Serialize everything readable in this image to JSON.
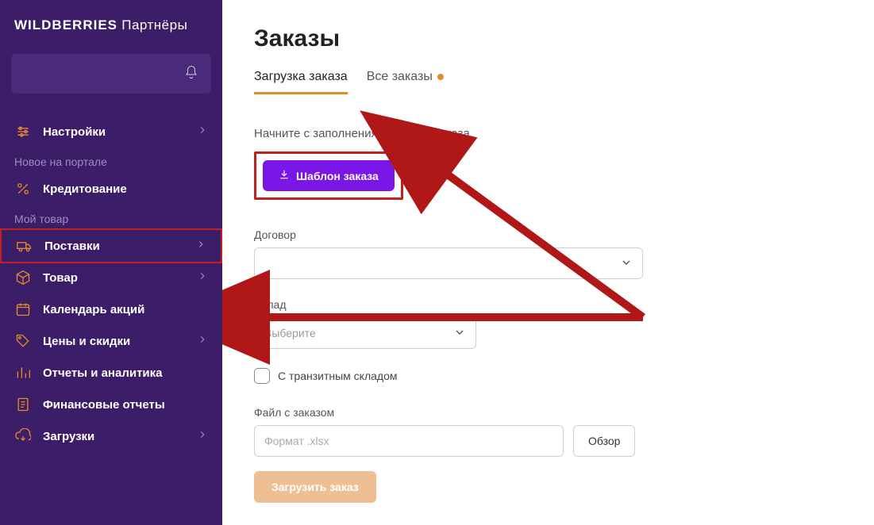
{
  "brand": {
    "logo": "WILDBERRIES",
    "sub": "Партнёры"
  },
  "sections": {
    "settings": "Настройки",
    "new_portal": "Новое на портале",
    "my_goods": "Мой товар"
  },
  "nav": {
    "credit": "Кредитование",
    "supplies": "Поставки",
    "product": "Товар",
    "calendar": "Календарь акций",
    "prices": "Цены и скидки",
    "reports": "Отчеты и аналитика",
    "fin": "Финансовые отчеты",
    "downloads": "Загрузки"
  },
  "main": {
    "title": "Заказы",
    "tabs": {
      "upload": "Загрузка заказа",
      "all": "Все заказы"
    },
    "hint": "Начните с заполнения шаблона заказа.",
    "template_btn": "Шаблон заказа",
    "contract_label": "Договор",
    "warehouse_label": "Склад",
    "warehouse_placeholder": "Выберите",
    "transit": "С транзитным складом",
    "file_label": "Файл с заказом",
    "file_placeholder": "Формат .xlsx",
    "browse": "Обзор",
    "upload_btn": "Загрузить заказ"
  }
}
